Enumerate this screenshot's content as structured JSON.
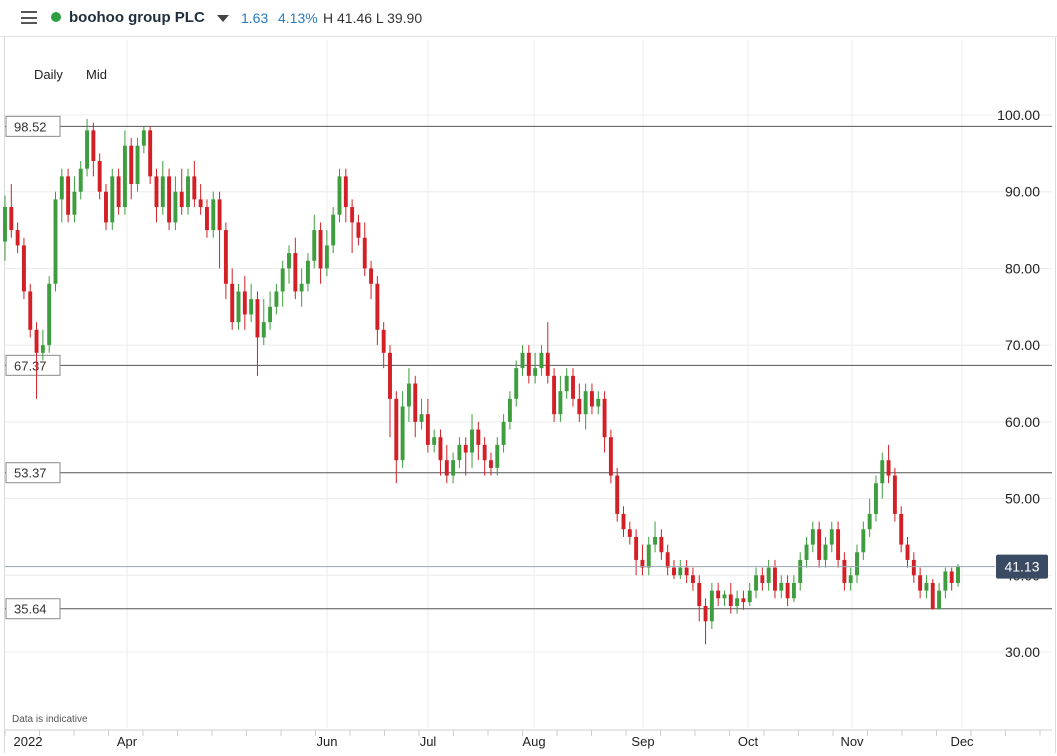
{
  "header": {
    "instrument": "boohoo group PLC",
    "change": "1.63",
    "change_pct": "4.13%",
    "high_low": "H 41.46 L 39.90",
    "icons": {
      "menu": "hamburger-menu-icon",
      "status": "live-status-dot-icon",
      "dropdown": "caret-down-icon"
    },
    "status_color": "#2ea043",
    "change_color": "#2a7bbf"
  },
  "controls": {
    "interval": "Daily",
    "price_type": "Mid"
  },
  "footer_note": "Data is indicative",
  "chart_data": {
    "type": "candlestick",
    "x_ticks": [
      "2022",
      "Apr",
      "Jun",
      "Jul",
      "Aug",
      "Sep",
      "Oct",
      "Nov",
      "Dec"
    ],
    "y_ticks": [
      "100.00",
      "90.00",
      "80.00",
      "70.00",
      "60.00",
      "50.00",
      "40.00",
      "30.00"
    ],
    "ylim": [
      30,
      100
    ],
    "grid": true,
    "up_color": "#3e9d3e",
    "down_color": "#d32027",
    "current_price": "41.13",
    "current_price_color": "#3b4a63",
    "horizontal_levels": [
      "98.52",
      "67.37",
      "53.37",
      "35.64"
    ],
    "candles": [
      [
        83.5,
        88,
        81,
        89.5
      ],
      [
        88,
        85,
        84,
        91
      ],
      [
        85,
        83,
        82,
        86
      ],
      [
        83,
        77,
        76,
        84
      ],
      [
        77,
        72,
        71,
        78
      ],
      [
        72,
        69,
        63,
        73
      ],
      [
        69,
        70,
        68,
        72
      ],
      [
        70,
        78,
        69,
        79
      ],
      [
        78,
        89,
        77,
        90
      ],
      [
        89,
        92,
        86,
        93
      ],
      [
        92,
        87,
        86,
        93
      ],
      [
        87,
        90,
        86,
        92
      ],
      [
        90,
        93,
        89,
        94
      ],
      [
        93,
        98,
        92,
        99.5
      ],
      [
        98,
        94,
        92,
        99
      ],
      [
        94,
        90,
        89,
        95
      ],
      [
        90,
        86,
        85,
        91
      ],
      [
        86,
        92,
        85,
        93
      ],
      [
        92,
        88,
        87,
        93
      ],
      [
        88,
        96,
        87,
        98
      ],
      [
        96,
        91,
        89,
        97
      ],
      [
        91,
        96,
        90,
        97
      ],
      [
        96,
        98,
        95,
        98.5
      ],
      [
        98,
        92,
        91,
        98.5
      ],
      [
        92,
        88,
        86,
        93
      ],
      [
        88,
        92,
        87,
        94
      ],
      [
        92,
        86,
        85,
        93
      ],
      [
        86,
        90,
        85,
        92
      ],
      [
        90,
        88,
        87,
        93
      ],
      [
        88,
        92,
        87,
        93
      ],
      [
        92,
        89,
        88,
        94
      ],
      [
        89,
        88,
        87,
        91
      ],
      [
        88,
        85,
        84,
        89
      ],
      [
        85,
        89,
        84,
        90
      ],
      [
        89,
        85,
        80,
        90
      ],
      [
        85,
        78,
        76,
        86
      ],
      [
        78,
        73,
        72,
        80
      ],
      [
        73,
        77,
        72,
        78
      ],
      [
        77,
        74,
        72,
        79
      ],
      [
        74,
        76,
        73,
        78
      ],
      [
        76,
        71,
        66,
        77
      ],
      [
        71,
        73,
        70,
        76
      ],
      [
        73,
        75,
        72,
        77
      ],
      [
        75,
        77,
        74,
        78
      ],
      [
        77,
        80,
        75,
        81
      ],
      [
        80,
        82,
        78,
        83
      ],
      [
        82,
        77,
        76,
        84
      ],
      [
        77,
        78,
        75,
        80
      ],
      [
        78,
        81,
        77,
        82
      ],
      [
        81,
        85,
        80,
        87
      ],
      [
        85,
        80,
        78,
        86
      ],
      [
        80,
        83,
        79,
        85
      ],
      [
        83,
        87,
        82,
        88
      ],
      [
        87,
        92,
        86,
        93
      ],
      [
        92,
        88,
        86,
        93
      ],
      [
        88,
        86,
        82,
        89
      ],
      [
        86,
        84,
        83,
        87
      ],
      [
        84,
        80,
        79,
        86
      ],
      [
        80,
        78,
        76,
        81
      ],
      [
        78,
        72,
        70,
        79
      ],
      [
        72,
        69,
        67,
        73
      ],
      [
        69,
        63,
        58,
        70
      ],
      [
        63,
        55,
        52,
        64
      ],
      [
        55,
        62,
        54,
        64
      ],
      [
        62,
        65,
        60,
        67
      ],
      [
        65,
        60,
        58,
        66
      ],
      [
        60,
        61,
        59,
        63
      ],
      [
        61,
        57,
        56,
        63
      ],
      [
        57,
        58,
        56,
        59
      ],
      [
        58,
        55,
        53,
        59
      ],
      [
        55,
        53,
        52,
        57
      ],
      [
        53,
        55,
        52,
        56
      ],
      [
        55,
        57,
        54,
        58
      ],
      [
        57,
        56,
        53,
        58
      ],
      [
        56,
        59,
        54,
        61
      ],
      [
        59,
        57,
        55,
        60
      ],
      [
        57,
        55,
        53,
        58
      ],
      [
        55,
        54,
        53,
        56
      ],
      [
        54,
        57,
        53,
        58
      ],
      [
        57,
        60,
        56,
        61
      ],
      [
        60,
        63,
        59,
        64
      ],
      [
        63,
        67,
        62,
        68
      ],
      [
        67,
        69,
        66,
        70
      ],
      [
        69,
        66,
        65,
        70
      ],
      [
        66,
        67,
        65,
        69
      ],
      [
        67,
        69,
        66,
        70
      ],
      [
        69,
        66,
        65,
        73
      ],
      [
        66,
        61,
        60,
        67
      ],
      [
        61,
        64,
        60,
        66
      ],
      [
        64,
        66,
        63,
        67
      ],
      [
        66,
        63,
        62,
        67
      ],
      [
        63,
        61,
        60,
        65
      ],
      [
        61,
        64,
        59,
        65
      ],
      [
        64,
        62,
        61,
        65
      ],
      [
        62,
        63,
        61,
        64
      ],
      [
        63,
        58,
        56,
        64
      ],
      [
        58,
        53,
        52,
        59
      ],
      [
        53,
        48,
        47,
        54
      ],
      [
        48,
        46,
        45,
        49
      ],
      [
        46,
        45,
        44,
        47
      ],
      [
        45,
        42,
        40,
        46
      ],
      [
        42,
        41,
        40,
        44
      ],
      [
        41,
        44,
        40,
        45
      ],
      [
        44,
        45,
        43,
        47
      ],
      [
        45,
        43,
        42,
        46
      ],
      [
        43,
        41,
        40,
        44
      ],
      [
        41,
        40,
        39.5,
        42
      ],
      [
        40,
        41,
        39.5,
        42
      ],
      [
        41,
        40,
        39,
        42
      ],
      [
        40,
        39,
        38,
        41
      ],
      [
        39,
        36,
        34,
        40
      ],
      [
        36,
        34,
        31,
        37
      ],
      [
        34,
        38,
        33,
        39
      ],
      [
        38,
        37,
        36,
        39
      ],
      [
        37,
        37.5,
        36,
        38
      ],
      [
        37.5,
        36,
        35,
        39
      ],
      [
        36,
        37,
        35,
        38
      ],
      [
        37,
        36.5,
        35.5,
        38
      ],
      [
        36.5,
        38,
        36,
        39
      ],
      [
        38,
        40,
        37,
        41
      ],
      [
        40,
        39,
        38,
        41
      ],
      [
        39,
        41,
        38,
        42
      ],
      [
        41,
        38,
        37,
        42
      ],
      [
        38,
        39,
        37,
        40
      ],
      [
        39,
        37,
        36,
        40
      ],
      [
        37,
        39,
        36.5,
        40
      ],
      [
        39,
        42,
        38,
        43
      ],
      [
        42,
        44,
        41,
        45
      ],
      [
        44,
        46,
        43,
        47
      ],
      [
        46,
        42,
        41,
        47
      ],
      [
        42,
        44,
        41,
        45
      ],
      [
        44,
        46,
        43,
        47
      ],
      [
        46,
        42,
        41,
        47
      ],
      [
        42,
        39,
        38,
        43
      ],
      [
        39,
        40,
        38,
        41
      ],
      [
        40,
        43,
        39,
        44
      ],
      [
        43,
        46,
        42,
        47
      ],
      [
        46,
        48,
        45,
        50
      ],
      [
        48,
        52,
        47,
        53
      ],
      [
        52,
        55,
        50,
        56
      ],
      [
        55,
        53,
        52,
        57
      ],
      [
        53,
        48,
        47,
        54
      ],
      [
        48,
        44,
        43,
        49
      ],
      [
        44,
        42,
        41,
        45
      ],
      [
        42,
        40,
        39,
        43
      ],
      [
        40,
        38,
        37,
        41
      ],
      [
        38,
        39,
        37,
        40
      ],
      [
        39,
        35.6,
        35.5,
        39.5
      ],
      [
        35.6,
        38,
        35.5,
        39
      ],
      [
        38,
        40.5,
        37,
        41
      ],
      [
        40.5,
        39,
        38,
        41
      ],
      [
        39,
        41.13,
        38.5,
        41.46
      ]
    ]
  }
}
